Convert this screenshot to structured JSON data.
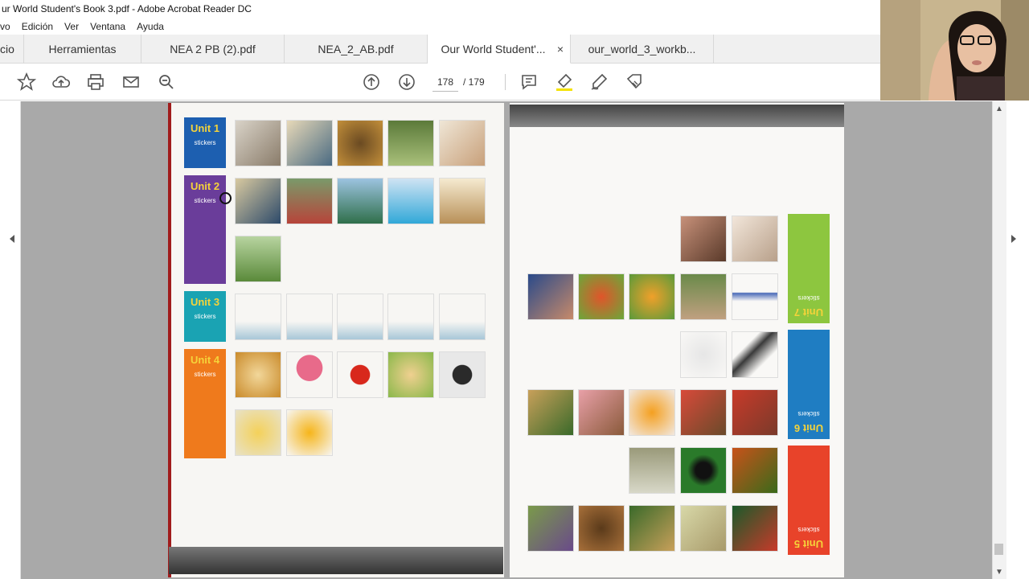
{
  "window": {
    "title": "ur World Student's Book 3.pdf - Adobe Acrobat Reader DC"
  },
  "menu": [
    "vo",
    "Edición",
    "Ver",
    "Ventana",
    "Ayuda"
  ],
  "tabs": [
    {
      "label": "cio"
    },
    {
      "label": "Herramientas"
    },
    {
      "label": "NEA 2 PB (2).pdf"
    },
    {
      "label": "NEA_2_AB.pdf"
    },
    {
      "label": "Our World Student'...",
      "active": true,
      "close": "×"
    },
    {
      "label": "our_world_3_workb..."
    }
  ],
  "toolbar": {
    "icons": [
      "star-icon",
      "cloud-upload-icon",
      "print-icon",
      "mail-icon",
      "zoom-icon",
      "page-up-icon",
      "page-down-icon",
      "comment-icon",
      "highlight-icon",
      "sign-icon",
      "edit-icon"
    ],
    "current_page": "178",
    "page_total": "/ 179"
  },
  "left_page": {
    "units": [
      {
        "unit": "Unit 1",
        "label": "stickers",
        "color": "#1d5fb0"
      },
      {
        "unit": "Unit 2",
        "label": "stickers",
        "color": "#6a3d9a"
      },
      {
        "unit": "Unit 3",
        "label": "stickers",
        "color": "#1aa3b3"
      },
      {
        "unit": "Unit 4",
        "label": "stickers",
        "color": "#ef7a1c"
      }
    ]
  },
  "right_page": {
    "units": [
      {
        "unit": "Unit 7",
        "label": "stickers",
        "color": "#8dc63f"
      },
      {
        "unit": "Unit 6",
        "label": "stickers",
        "color": "#1f7dc2"
      },
      {
        "unit": "Unit 5",
        "label": "stickers",
        "color": "#e8432a"
      }
    ]
  }
}
